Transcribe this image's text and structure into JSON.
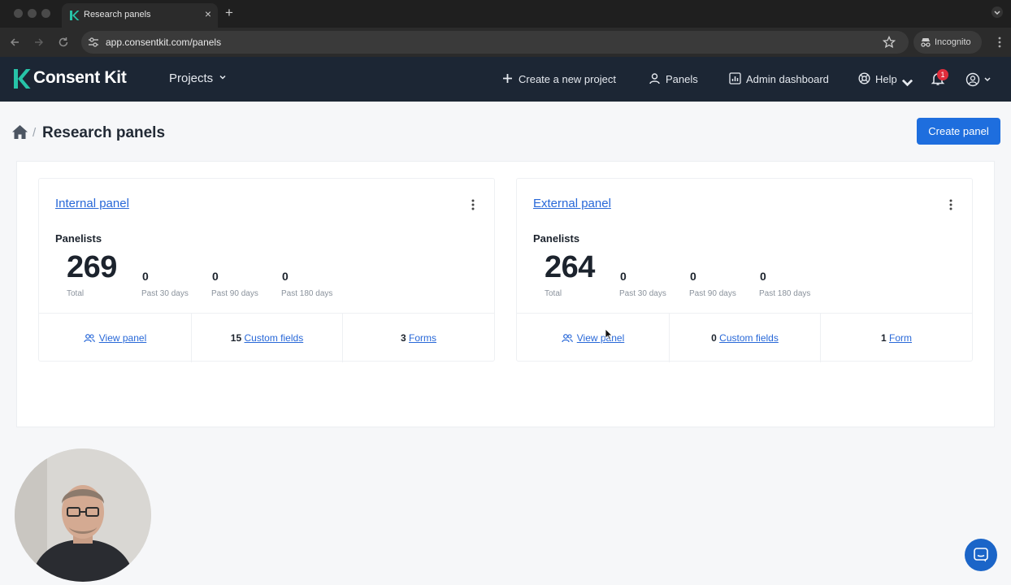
{
  "browser": {
    "tab_title": "Research panels",
    "new_tab_symbol": "+",
    "close_symbol": "×",
    "url": "app.consentkit.com/panels",
    "incognito_label": "Incognito"
  },
  "header": {
    "logo_text": "Consent Kit",
    "projects_label": "Projects",
    "nav": [
      {
        "label": "Create a new project",
        "icon": "plus-icon"
      },
      {
        "label": "Panels",
        "icon": "people-icon"
      },
      {
        "label": "Admin dashboard",
        "icon": "chart-icon"
      },
      {
        "label": "Help",
        "icon": "lifebuoy-icon"
      }
    ],
    "notification_count": "1"
  },
  "page": {
    "breadcrumb_separator": "/",
    "title": "Research panels",
    "create_button": "Create panel"
  },
  "panels": [
    {
      "name": "Internal panel",
      "panelists_label": "Panelists",
      "total": "269",
      "total_label": "Total",
      "stats": [
        {
          "value": "0",
          "label": "Past 30 days"
        },
        {
          "value": "0",
          "label": "Past 90 days"
        },
        {
          "value": "0",
          "label": "Past 180 days"
        }
      ],
      "view_label": "View panel",
      "custom_fields_count": "15",
      "custom_fields_label": "Custom fields",
      "forms_count": "3",
      "forms_label": "Forms"
    },
    {
      "name": "External panel",
      "panelists_label": "Panelists",
      "total": "264",
      "total_label": "Total",
      "stats": [
        {
          "value": "0",
          "label": "Past 30 days"
        },
        {
          "value": "0",
          "label": "Past 90 days"
        },
        {
          "value": "0",
          "label": "Past 180 days"
        }
      ],
      "view_label": "View panel",
      "custom_fields_count": "0",
      "custom_fields_label": "Custom fields",
      "forms_count": "1",
      "forms_label": "Form"
    }
  ],
  "colors": {
    "brand_teal": "#27c4a8",
    "nav_bg": "#1c2634",
    "primary_blue": "#1e6ede",
    "link_blue": "#2868d8",
    "badge_red": "#e02d3c"
  }
}
